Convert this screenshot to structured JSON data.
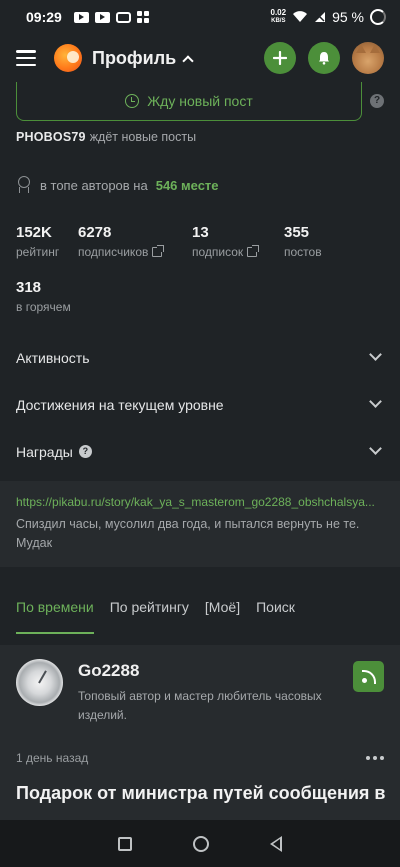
{
  "status_bar": {
    "time": "09:29",
    "speed_value": "0.02",
    "speed_unit": "KB/S",
    "battery": "95 %"
  },
  "header": {
    "title": "Профиль"
  },
  "profile": {
    "wait_button_label": "Жду новый пост",
    "waiting_user": "PHOBOS79",
    "waiting_text": "ждёт новые посты",
    "top_authors_prefix": "в топе авторов на",
    "top_authors_place": "546 месте",
    "stats": [
      {
        "value": "152K",
        "label": "рейтинг"
      },
      {
        "value": "6278",
        "label": "подписчиков"
      },
      {
        "value": "13",
        "label": "подписок"
      },
      {
        "value": "355",
        "label": "постов"
      },
      {
        "value": "318",
        "label": "в горячем"
      }
    ],
    "sections": [
      "Активность",
      "Достижения на текущем уровне",
      "Награды"
    ],
    "bio_link": "https://pikabu.ru/story/kak_ya_s_masterom_go2288_obshchalsya...",
    "bio_text": "Спиздил часы, мусолил два года, и пытался вернуть не те. Мудак"
  },
  "tabs": [
    "По времени",
    "По рейтингу",
    "[Моё]",
    "Поиск"
  ],
  "author_card": {
    "name": "Go2288",
    "description": "Топовый автор и мастер любитель часовых изделий."
  },
  "post": {
    "time_ago": "1 день назад",
    "title": "Подарок от министра путей сообщения в"
  },
  "colors": {
    "accent_green": "#6db15a",
    "button_green": "#4c8f3a",
    "background": "#1f2326",
    "card": "#272b2e"
  }
}
